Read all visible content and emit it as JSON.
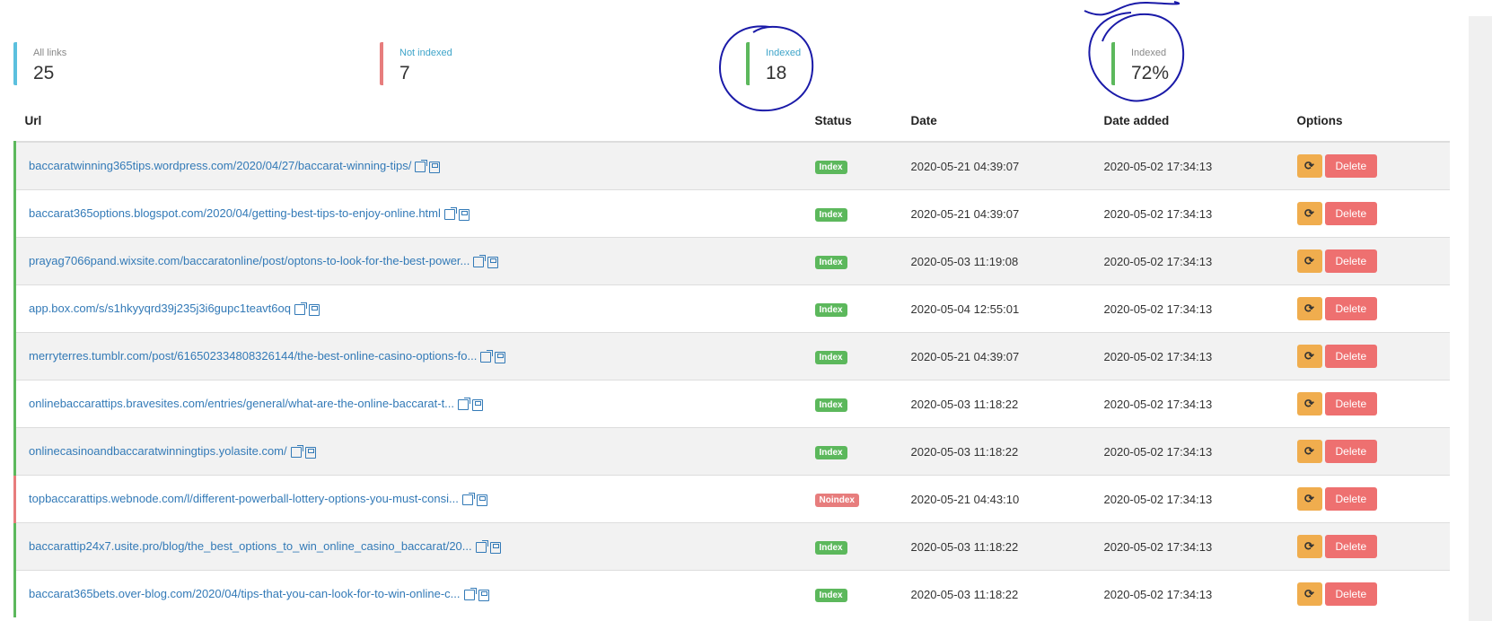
{
  "stats": [
    {
      "label": "All links",
      "value": "25"
    },
    {
      "label": "Not indexed",
      "value": "7"
    },
    {
      "label": "Indexed",
      "value": "18"
    },
    {
      "label": "Indexed",
      "value": "72%"
    }
  ],
  "table": {
    "headers": {
      "url": "Url",
      "status": "Status",
      "date": "Date",
      "date_added": "Date added",
      "options": "Options"
    },
    "delete_label": "Delete",
    "rows": [
      {
        "url": "baccaratwinning365tips.wordpress.com/2020/04/27/baccarat-winning-tips/",
        "status": "Index",
        "date": "2020-05-21 04:39:07",
        "date_added": "2020-05-02 17:34:13"
      },
      {
        "url": "baccarat365options.blogspot.com/2020/04/getting-best-tips-to-enjoy-online.html",
        "status": "Index",
        "date": "2020-05-21 04:39:07",
        "date_added": "2020-05-02 17:34:13"
      },
      {
        "url": "prayag7066pand.wixsite.com/baccaratonline/post/optons-to-look-for-the-best-power...",
        "status": "Index",
        "date": "2020-05-03 11:19:08",
        "date_added": "2020-05-02 17:34:13"
      },
      {
        "url": "app.box.com/s/s1hkyyqrd39j235j3i6gupc1teavt6oq",
        "status": "Index",
        "date": "2020-05-04 12:55:01",
        "date_added": "2020-05-02 17:34:13"
      },
      {
        "url": "merryterres.tumblr.com/post/616502334808326144/the-best-online-casino-options-fo...",
        "status": "Index",
        "date": "2020-05-21 04:39:07",
        "date_added": "2020-05-02 17:34:13"
      },
      {
        "url": "onlinebaccarattips.bravesites.com/entries/general/what-are-the-online-baccarat-t...",
        "status": "Index",
        "date": "2020-05-03 11:18:22",
        "date_added": "2020-05-02 17:34:13"
      },
      {
        "url": "onlinecasinoandbaccaratwinningtips.yolasite.com/",
        "status": "Index",
        "date": "2020-05-03 11:18:22",
        "date_added": "2020-05-02 17:34:13"
      },
      {
        "url": "topbaccarattips.webnode.com/l/different-powerball-lottery-options-you-must-consi...",
        "status": "Noindex",
        "date": "2020-05-21 04:43:10",
        "date_added": "2020-05-02 17:34:13"
      },
      {
        "url": "baccarattip24x7.usite.pro/blog/the_best_options_to_win_online_casino_baccarat/20...",
        "status": "Index",
        "date": "2020-05-03 11:18:22",
        "date_added": "2020-05-02 17:34:13"
      },
      {
        "url": "baccarat365bets.over-blog.com/2020/04/tips-that-you-can-look-for-to-win-online-c...",
        "status": "Index",
        "date": "2020-05-03 11:18:22",
        "date_added": "2020-05-02 17:34:13"
      }
    ]
  },
  "colors": {
    "index_badge": "#5cb85c",
    "noindex_badge": "#e77d7d",
    "link": "#337ab7",
    "refresh_button": "#f0ad4e",
    "delete_button": "#ee7070",
    "annotation_ink": "#1a1aa8"
  }
}
